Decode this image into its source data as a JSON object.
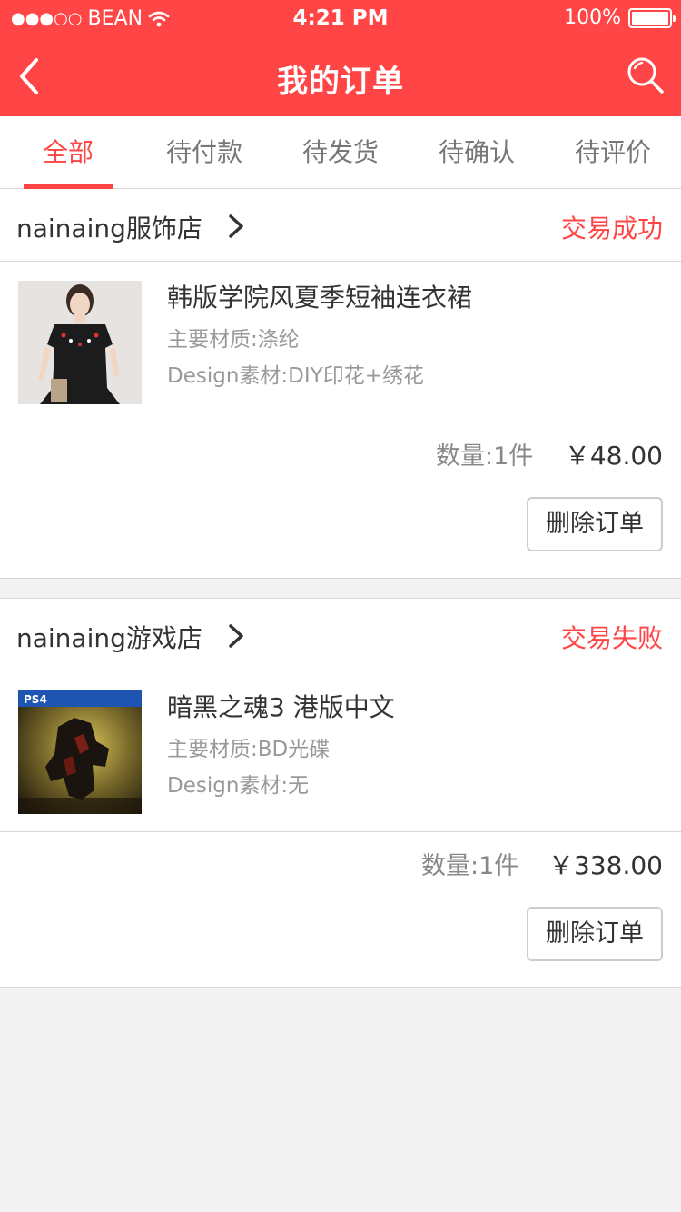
{
  "status_bar": {
    "signal_dots": "●●●○○",
    "carrier": "BEAN",
    "time": "4:21 PM",
    "battery": "100%"
  },
  "nav": {
    "title": "我的订单",
    "back_icon": "chevron-left-icon",
    "search_icon": "search-icon"
  },
  "tabs": [
    {
      "label": "全部",
      "active": true
    },
    {
      "label": "待付款"
    },
    {
      "label": "待发货"
    },
    {
      "label": "待确认"
    },
    {
      "label": "待评价"
    }
  ],
  "orders": [
    {
      "shop": "nainaing服饰店",
      "status": "交易成功",
      "product": {
        "title": "韩版学院风夏季短袖连衣裙",
        "material": "主要材质:涤纶",
        "design": "Design素材:DIY印花+绣花"
      },
      "quantity": "数量:1件",
      "price": "￥48.00",
      "delete_label": "删除订单"
    },
    {
      "shop": "nainaing游戏店",
      "status": "交易失败",
      "product": {
        "title": "暗黑之魂3 港版中文",
        "material": "主要材质:BD光碟",
        "design": "Design素材:无",
        "badge": "PS4"
      },
      "quantity": "数量:1件",
      "price": "￥338.00",
      "delete_label": "删除订单"
    }
  ],
  "colors": {
    "brand": "#ff4545",
    "background": "#f2f2f2",
    "muted": "#999999"
  }
}
